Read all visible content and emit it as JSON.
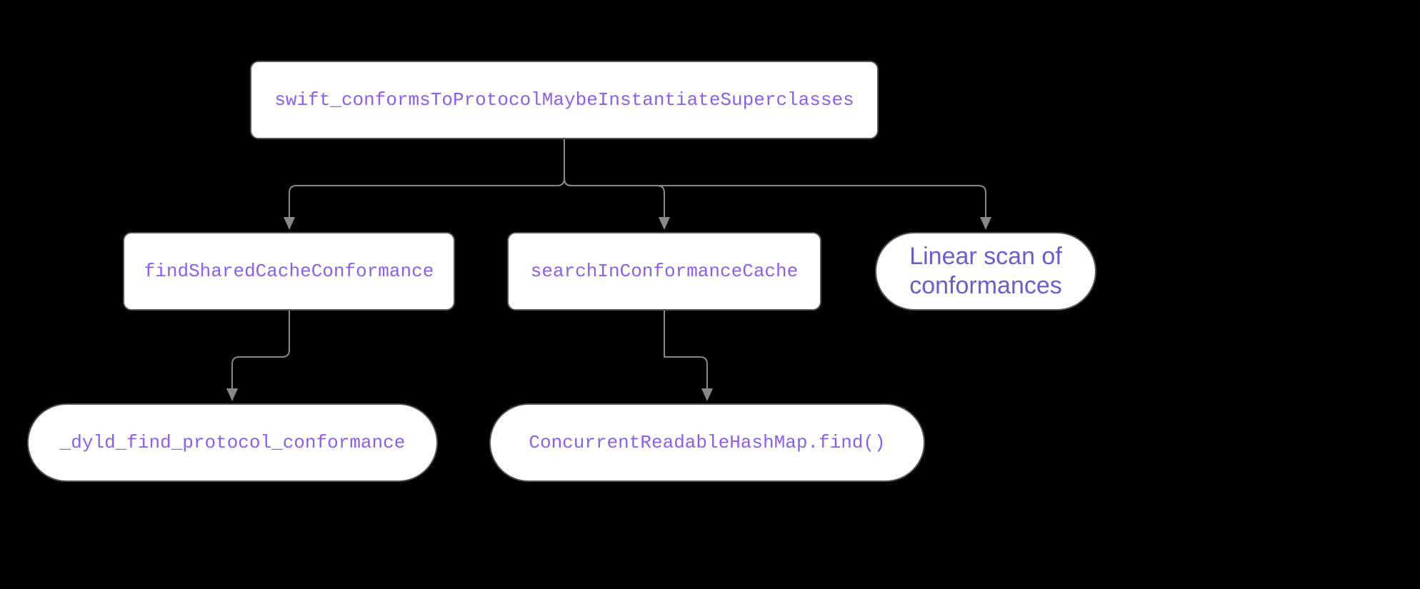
{
  "nodes": {
    "root": {
      "label": "swift_conformsToProtocolMaybeInstantiateSuperclasses",
      "type": "code-rect"
    },
    "findShared": {
      "label": "findSharedCacheConformance",
      "type": "code-rect"
    },
    "searchIn": {
      "label": "searchInConformanceCache",
      "type": "code-rect"
    },
    "linearScan": {
      "label_line1": "Linear scan of",
      "label_line2": "conformances",
      "type": "text-rounded"
    },
    "dyld": {
      "label": "_dyld_find_protocol_conformance",
      "type": "code-rounded"
    },
    "hashmap": {
      "label": "ConcurrentReadableHashMap.find()",
      "type": "code-rounded"
    }
  },
  "edges": [
    {
      "from": "root",
      "to": "findShared"
    },
    {
      "from": "root",
      "to": "searchIn"
    },
    {
      "from": "root",
      "to": "linearScan"
    },
    {
      "from": "findShared",
      "to": "dyld"
    },
    {
      "from": "searchIn",
      "to": "hashmap"
    }
  ]
}
